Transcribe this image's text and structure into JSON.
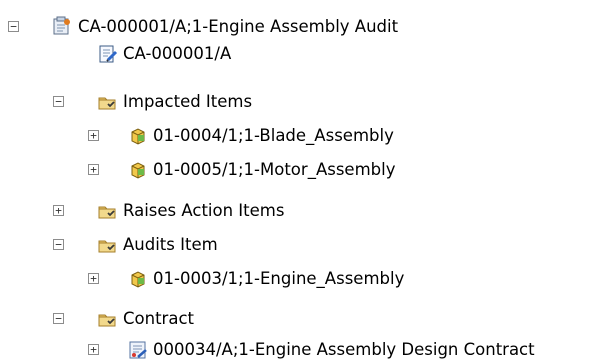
{
  "tree": {
    "nodes": [
      {
        "label": "CA-000001/A;1-Engine Assembly Audit",
        "icon": "change-audit-icon",
        "toggle": "minus",
        "level": 0
      },
      {
        "label": "CA-000001/A",
        "icon": "revision-doc-icon",
        "toggle": "",
        "level": 1
      },
      {
        "label": "Impacted Items",
        "icon": "folder-icon",
        "toggle": "minus",
        "level": 1
      },
      {
        "label": "01-0004/1;1-Blade_Assembly",
        "icon": "item-revision-icon",
        "toggle": "plus",
        "level": 2
      },
      {
        "label": "01-0005/1;1-Motor_Assembly",
        "icon": "item-revision-icon",
        "toggle": "plus",
        "level": 2
      },
      {
        "label": "Raises Action Items",
        "icon": "folder-icon",
        "toggle": "plus",
        "level": 1
      },
      {
        "label": "Audits Item",
        "icon": "folder-icon",
        "toggle": "minus",
        "level": 1
      },
      {
        "label": "01-0003/1;1-Engine_Assembly",
        "icon": "item-revision-icon",
        "toggle": "plus",
        "level": 2
      },
      {
        "label": "Contract",
        "icon": "folder-icon",
        "toggle": "minus",
        "level": 1
      },
      {
        "label": "000034/A;1-Engine Assembly Design Contract",
        "icon": "contract-icon",
        "toggle": "plus",
        "level": 2
      }
    ]
  }
}
